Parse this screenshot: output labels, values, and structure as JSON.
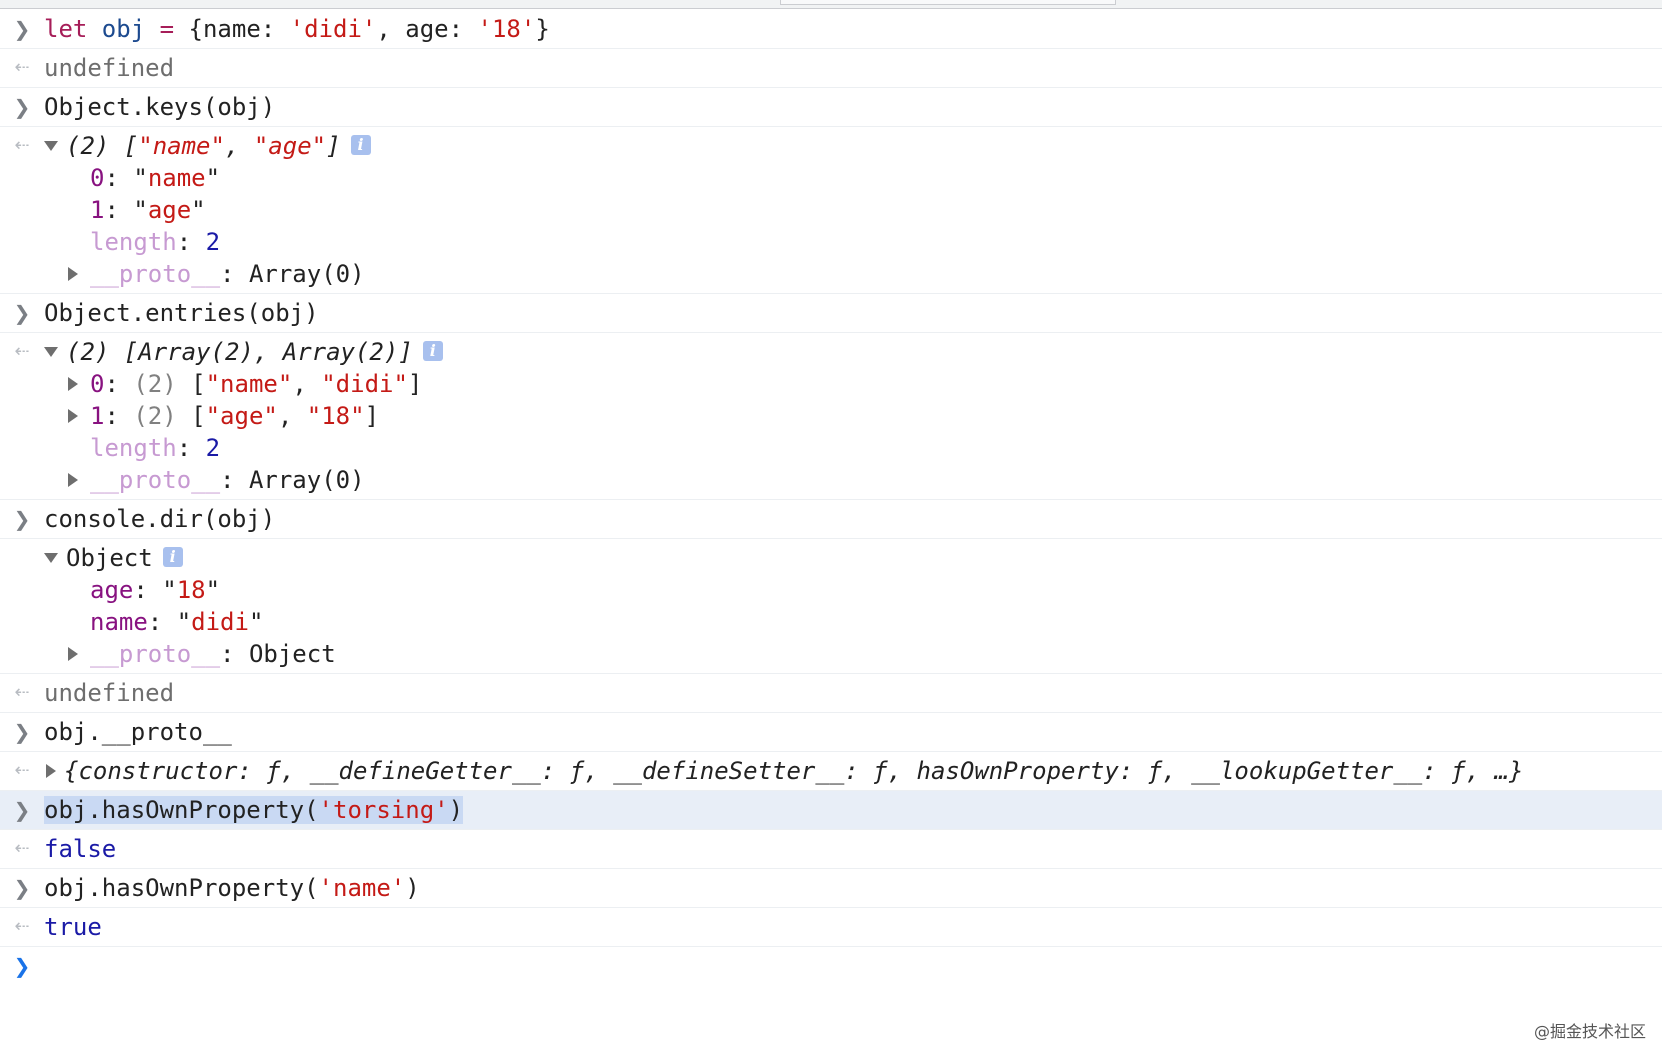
{
  "entries": [
    {
      "kind": "input",
      "tokens": [
        {
          "t": "let ",
          "c": "kw"
        },
        {
          "t": "obj",
          "c": "var"
        },
        {
          "t": " = ",
          "c": "op"
        },
        {
          "t": "{name: ",
          "c": "plain"
        },
        {
          "t": "'didi'",
          "c": "str"
        },
        {
          "t": ", age: ",
          "c": "plain"
        },
        {
          "t": "'18'",
          "c": "str"
        },
        {
          "t": "}",
          "c": "plain"
        }
      ]
    },
    {
      "kind": "output_text",
      "text": "undefined",
      "style": "undef"
    },
    {
      "kind": "input",
      "tokens": [
        {
          "t": "Object.keys(obj)",
          "c": "plain"
        }
      ]
    },
    {
      "kind": "output_tree",
      "summary": [
        {
          "t": "(2) [",
          "c": "plain",
          "i": true
        },
        {
          "t": "\"name\"",
          "c": "str",
          "i": true
        },
        {
          "t": ", ",
          "c": "plain",
          "i": true
        },
        {
          "t": "\"age\"",
          "c": "str",
          "i": true
        },
        {
          "t": "]",
          "c": "plain",
          "i": true
        }
      ],
      "info_badge": "i",
      "children": [
        {
          "expand": false,
          "tokens": [
            {
              "t": "0",
              "c": "idx"
            },
            {
              "t": ": ",
              "c": "plain"
            },
            {
              "t": "\"",
              "c": "plain"
            },
            {
              "t": "name",
              "c": "str"
            },
            {
              "t": "\"",
              "c": "plain"
            }
          ]
        },
        {
          "expand": false,
          "tokens": [
            {
              "t": "1",
              "c": "idx"
            },
            {
              "t": ": ",
              "c": "plain"
            },
            {
              "t": "\"",
              "c": "plain"
            },
            {
              "t": "age",
              "c": "str"
            },
            {
              "t": "\"",
              "c": "plain"
            }
          ]
        },
        {
          "expand": false,
          "tokens": [
            {
              "t": "length",
              "c": "protokey"
            },
            {
              "t": ": ",
              "c": "plain"
            },
            {
              "t": "2",
              "c": "num"
            }
          ]
        },
        {
          "expand": true,
          "tokens": [
            {
              "t": "__proto__",
              "c": "protokey"
            },
            {
              "t": ": Array(0)",
              "c": "plain"
            }
          ]
        }
      ]
    },
    {
      "kind": "input",
      "tokens": [
        {
          "t": "Object.entries(obj)",
          "c": "plain"
        }
      ]
    },
    {
      "kind": "output_tree",
      "summary": [
        {
          "t": "(2) [Array(2), Array(2)]",
          "c": "plain",
          "i": true
        }
      ],
      "info_badge": "i",
      "children": [
        {
          "expand": true,
          "tokens": [
            {
              "t": "0",
              "c": "idx"
            },
            {
              "t": ": ",
              "c": "plain"
            },
            {
              "t": "(2) ",
              "c": "grey"
            },
            {
              "t": "[",
              "c": "plain"
            },
            {
              "t": "\"name\"",
              "c": "str"
            },
            {
              "t": ", ",
              "c": "plain"
            },
            {
              "t": "\"didi\"",
              "c": "str"
            },
            {
              "t": "]",
              "c": "plain"
            }
          ]
        },
        {
          "expand": true,
          "tokens": [
            {
              "t": "1",
              "c": "idx"
            },
            {
              "t": ": ",
              "c": "plain"
            },
            {
              "t": "(2) ",
              "c": "grey"
            },
            {
              "t": "[",
              "c": "plain"
            },
            {
              "t": "\"age\"",
              "c": "str"
            },
            {
              "t": ", ",
              "c": "plain"
            },
            {
              "t": "\"18\"",
              "c": "str"
            },
            {
              "t": "]",
              "c": "plain"
            }
          ]
        },
        {
          "expand": false,
          "tokens": [
            {
              "t": "length",
              "c": "protokey"
            },
            {
              "t": ": ",
              "c": "plain"
            },
            {
              "t": "2",
              "c": "num"
            }
          ]
        },
        {
          "expand": true,
          "tokens": [
            {
              "t": "__proto__",
              "c": "protokey"
            },
            {
              "t": ": Array(0)",
              "c": "plain"
            }
          ]
        }
      ]
    },
    {
      "kind": "input",
      "tokens": [
        {
          "t": "console.dir(obj)",
          "c": "plain"
        }
      ]
    },
    {
      "kind": "log_tree",
      "summary": [
        {
          "t": "Object",
          "c": "plain",
          "i": false
        }
      ],
      "info_badge": "i",
      "children": [
        {
          "expand": false,
          "tokens": [
            {
              "t": "age",
              "c": "prop"
            },
            {
              "t": ": ",
              "c": "plain"
            },
            {
              "t": "\"",
              "c": "plain"
            },
            {
              "t": "18",
              "c": "str"
            },
            {
              "t": "\"",
              "c": "plain"
            }
          ]
        },
        {
          "expand": false,
          "tokens": [
            {
              "t": "name",
              "c": "prop"
            },
            {
              "t": ": ",
              "c": "plain"
            },
            {
              "t": "\"",
              "c": "plain"
            },
            {
              "t": "didi",
              "c": "str"
            },
            {
              "t": "\"",
              "c": "plain"
            }
          ]
        },
        {
          "expand": true,
          "tokens": [
            {
              "t": "__proto__",
              "c": "protokey"
            },
            {
              "t": ": Object",
              "c": "plain"
            }
          ]
        }
      ]
    },
    {
      "kind": "output_text",
      "text": "undefined",
      "style": "undef"
    },
    {
      "kind": "input",
      "tokens": [
        {
          "t": "obj.__proto__",
          "c": "plain"
        }
      ]
    },
    {
      "kind": "output_collapsed",
      "tokens": [
        {
          "t": "{constructor: ",
          "c": "plain",
          "i": true
        },
        {
          "t": "ƒ",
          "c": "plain",
          "i": true
        },
        {
          "t": ", __defineGetter__: ",
          "c": "plain",
          "i": true
        },
        {
          "t": "ƒ",
          "c": "plain",
          "i": true
        },
        {
          "t": ", __defineSetter__: ",
          "c": "plain",
          "i": true
        },
        {
          "t": "ƒ",
          "c": "plain",
          "i": true
        },
        {
          "t": ", hasOwnProperty: ",
          "c": "plain",
          "i": true
        },
        {
          "t": "ƒ",
          "c": "plain",
          "i": true
        },
        {
          "t": ", __lookupGetter__: ",
          "c": "plain",
          "i": true
        },
        {
          "t": "ƒ",
          "c": "plain",
          "i": true
        },
        {
          "t": ", …}",
          "c": "plain",
          "i": true
        }
      ]
    },
    {
      "kind": "input",
      "selected": true,
      "tokens": [
        {
          "t": "obj.hasOwnProperty(",
          "c": "plain",
          "sel": true
        },
        {
          "t": "'torsing'",
          "c": "str",
          "sel": true
        },
        {
          "t": ")",
          "c": "plain",
          "sel": true
        }
      ]
    },
    {
      "kind": "output_text",
      "text": "false",
      "style": "bool"
    },
    {
      "kind": "input",
      "tokens": [
        {
          "t": "obj.hasOwnProperty(",
          "c": "plain"
        },
        {
          "t": "'name'",
          "c": "str"
        },
        {
          "t": ")",
          "c": "plain"
        }
      ]
    },
    {
      "kind": "output_text",
      "text": "true",
      "style": "bool"
    },
    {
      "kind": "prompt"
    }
  ],
  "gutter_glyphs": {
    "input": "❯",
    "output": "⇠",
    "prompt": "❯"
  },
  "colors": {
    "keyword": "#a61d58",
    "string": "#c41a16",
    "number_bool": "#1a1aa6",
    "index": "#881280",
    "proto_key": "#c79ad2",
    "selection": "#c9d9f3",
    "selected_row": "#e8eef7",
    "prompt": "#1a73e8"
  },
  "watermark": "@掘金技术社区"
}
